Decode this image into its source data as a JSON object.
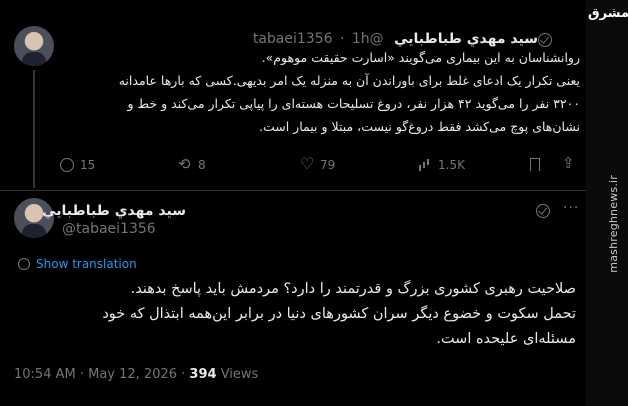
{
  "tweet1": {
    "author_name": "سید مهدي طباطبایي",
    "handle": "@tabaei1356",
    "separator": "·",
    "time": "1h",
    "text_lines": [
      "روانشناسان به این بیماری می‌گویند «اسارت حقیقت موهوم».",
      "یعنی تکرار یک ادعای غلط برای باوراندن آن به منزله یک امر بدیهی.کسی که بارها عامدانه",
      "۳۲۰۰ نفر را می‌گوید ۴۲ هزار نفر، دروغ تسلیحات هسته‌ای را پیاپی تکرار می‌کند و خط و",
      "نشان‌های پوچ می‌کشد فقط دروغ‌گو نیست، مبتلا و بیمار است."
    ],
    "stats": {
      "replies": "15",
      "reposts": "8",
      "likes": "79",
      "views": "1.5K"
    }
  },
  "tweet2": {
    "author_name": "سید مهدي طباطبایي",
    "handle": "@tabaei1356",
    "show_translation": "Show translation",
    "text_lines": [
      "صلاحیت رهبری کشوری بزرگ و قدرتمند را دارد؟ مردمش باید پاسخ بدهند.",
      "تحمل سکوت و خضوع دیگر سران کشورهای دنیا در برابر این‌همه ابتذال که خود",
      "مسئله‌ای علیحده است."
    ],
    "timestamp": "10:54 AM · May 12, 2026 ·",
    "views_count": "394",
    "views_label": "Views"
  },
  "watermark": {
    "logo_text": "مشرق",
    "site_url": "mashreghnews.ir"
  },
  "colors": {
    "background": "#000000",
    "text": "#e7e9ea",
    "muted": "#71767b",
    "link": "#1d9bf0",
    "divider": "#2f3336"
  }
}
